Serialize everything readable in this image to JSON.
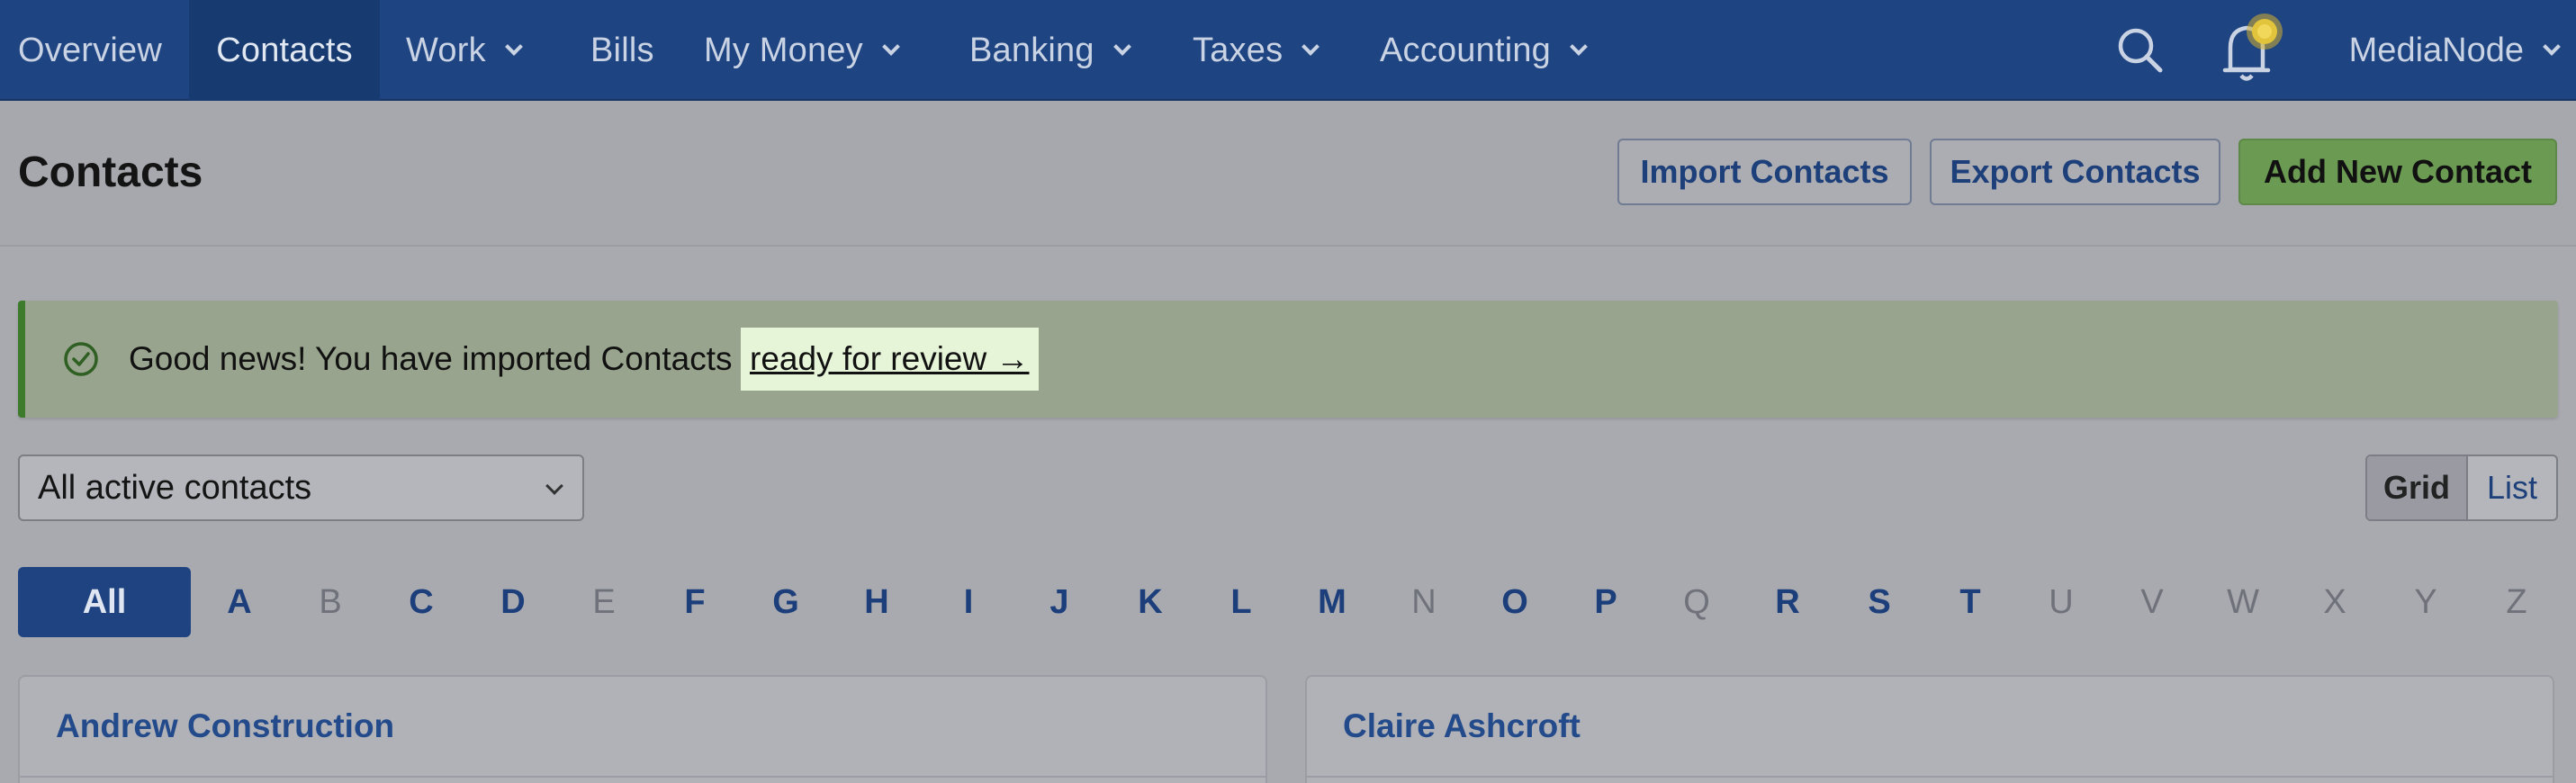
{
  "nav": {
    "items": [
      {
        "label": "Overview",
        "dropdown": false
      },
      {
        "label": "Contacts",
        "dropdown": false,
        "active": true
      },
      {
        "label": "Work",
        "dropdown": true
      },
      {
        "label": "Bills",
        "dropdown": false
      },
      {
        "label": "My Money",
        "dropdown": true
      },
      {
        "label": "Banking",
        "dropdown": true
      },
      {
        "label": "Taxes",
        "dropdown": true
      },
      {
        "label": "Accounting",
        "dropdown": true
      }
    ],
    "search_icon": "search-icon",
    "notification_icon": "bell-icon",
    "user": "MediaNode"
  },
  "header": {
    "title": "Contacts",
    "import_label": "Import Contacts",
    "export_label": "Export Contacts",
    "add_label": "Add New Contact"
  },
  "banner": {
    "icon": "check-circle-icon",
    "text": "Good news! You have imported Contacts",
    "link": "ready for review →"
  },
  "filter": {
    "selected": "All active contacts",
    "view_grid": "Grid",
    "view_list": "List",
    "active_view": "Grid"
  },
  "alphabet": {
    "all": "All",
    "letters": [
      {
        "l": "A",
        "on": true
      },
      {
        "l": "B",
        "on": false
      },
      {
        "l": "C",
        "on": true
      },
      {
        "l": "D",
        "on": true
      },
      {
        "l": "E",
        "on": false
      },
      {
        "l": "F",
        "on": true
      },
      {
        "l": "G",
        "on": true
      },
      {
        "l": "H",
        "on": true
      },
      {
        "l": "I",
        "on": true
      },
      {
        "l": "J",
        "on": true
      },
      {
        "l": "K",
        "on": true
      },
      {
        "l": "L",
        "on": true
      },
      {
        "l": "M",
        "on": true
      },
      {
        "l": "N",
        "on": false
      },
      {
        "l": "O",
        "on": true
      },
      {
        "l": "P",
        "on": true
      },
      {
        "l": "Q",
        "on": false
      },
      {
        "l": "R",
        "on": true
      },
      {
        "l": "S",
        "on": true
      },
      {
        "l": "T",
        "on": true
      },
      {
        "l": "U",
        "on": false
      },
      {
        "l": "V",
        "on": false
      },
      {
        "l": "W",
        "on": false
      },
      {
        "l": "X",
        "on": false
      },
      {
        "l": "Y",
        "on": false
      },
      {
        "l": "Z",
        "on": false
      }
    ]
  },
  "contacts": [
    {
      "name": "Andrew Construction"
    },
    {
      "name": "Claire Ashcroft"
    }
  ],
  "colors": {
    "nav_bg": "#1f4482",
    "accent_blue": "#1e4380",
    "success_green": "#6b9a53",
    "banner_bg": "#98a48d"
  }
}
